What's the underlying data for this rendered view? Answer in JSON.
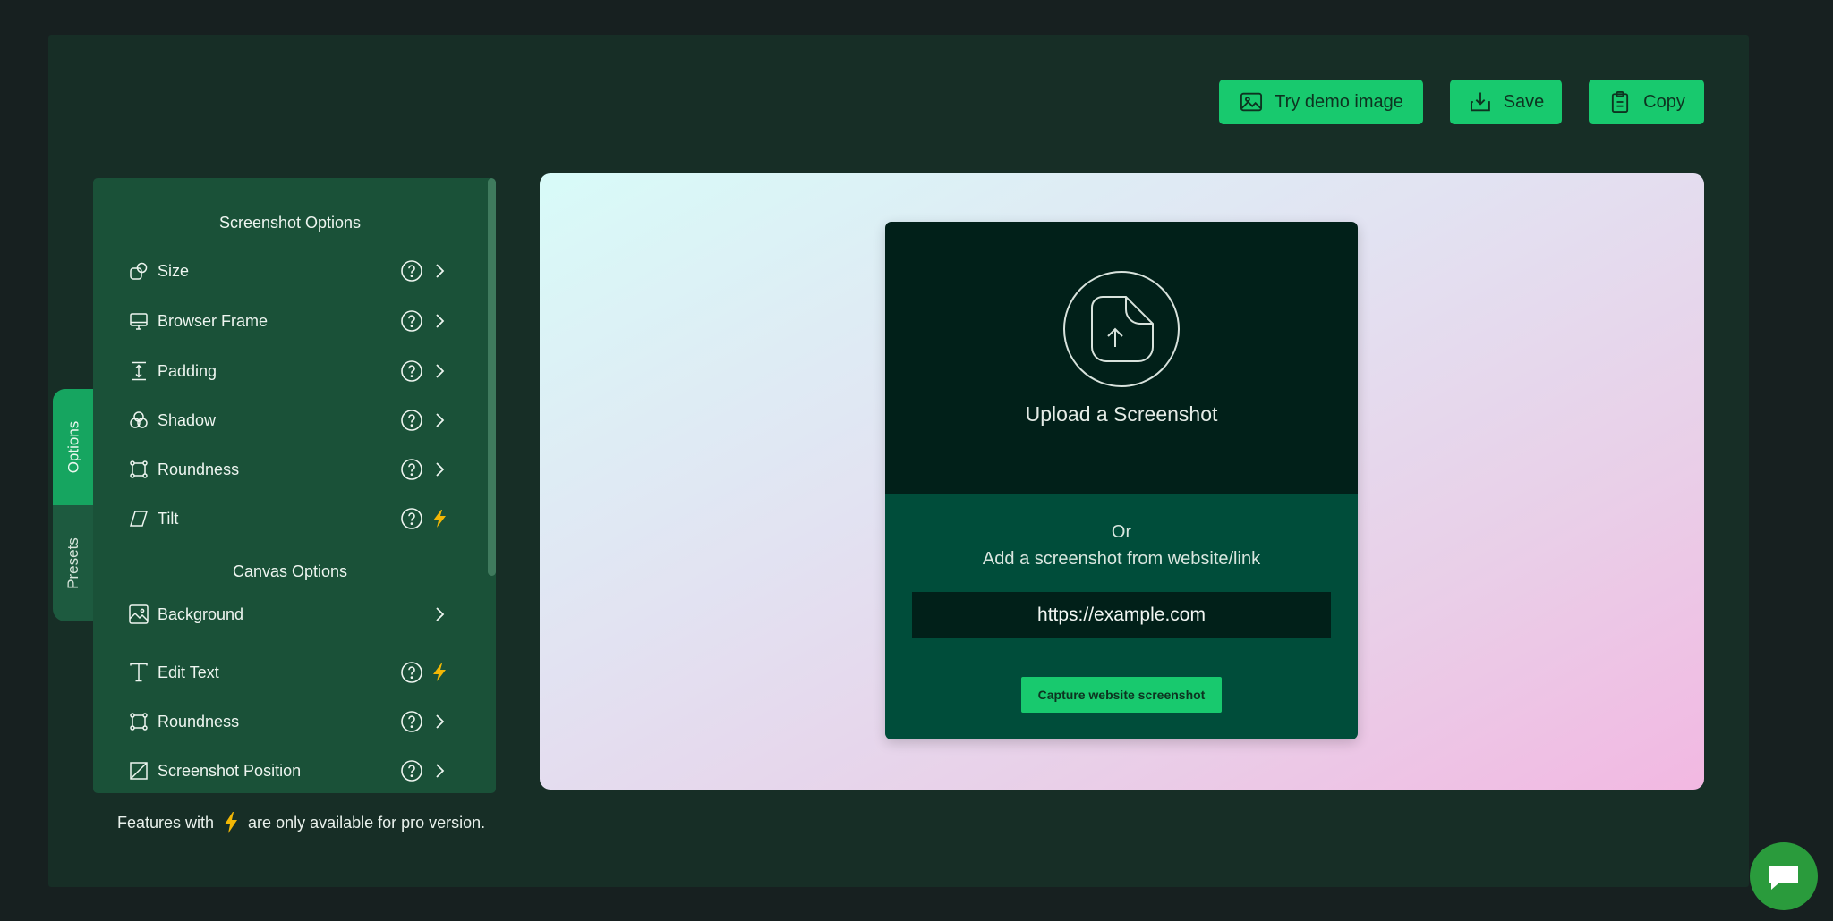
{
  "toolbar": {
    "demo_label": "Try demo image",
    "save_label": "Save",
    "copy_label": "Copy"
  },
  "side_tabs": {
    "options": "Options",
    "presets": "Presets",
    "active": "Options"
  },
  "panel": {
    "screenshot_title": "Screenshot Options",
    "canvas_title": "Canvas Options",
    "screenshot_items": [
      {
        "label": "Size",
        "icon": "shapes-icon",
        "help": true,
        "trailing": "chevron"
      },
      {
        "label": "Browser Frame",
        "icon": "monitor-icon",
        "help": true,
        "trailing": "chevron"
      },
      {
        "label": "Padding",
        "icon": "padding-icon",
        "help": true,
        "trailing": "chevron"
      },
      {
        "label": "Shadow",
        "icon": "shadow-icon",
        "help": true,
        "trailing": "chevron"
      },
      {
        "label": "Roundness",
        "icon": "roundness-icon",
        "help": true,
        "trailing": "chevron"
      },
      {
        "label": "Tilt",
        "icon": "tilt-icon",
        "help": true,
        "trailing": "pro-bolt"
      }
    ],
    "canvas_items": [
      {
        "label": "Background",
        "icon": "image-icon",
        "help": false,
        "trailing": "chevron"
      },
      {
        "label": "Edit Text",
        "icon": "text-icon",
        "help": true,
        "trailing": "pro-bolt"
      },
      {
        "label": "Roundness",
        "icon": "roundness-icon",
        "help": true,
        "trailing": "chevron"
      },
      {
        "label": "Screenshot Position",
        "icon": "position-icon",
        "help": true,
        "trailing": "chevron"
      }
    ]
  },
  "footnote": {
    "before": "Features with",
    "after": "are only available for pro version."
  },
  "uploader": {
    "title": "Upload a Screenshot",
    "or": "Or",
    "add_text": "Add a screenshot from website/link",
    "url_placeholder": "https://example.com",
    "capture_label": "Capture website screenshot"
  },
  "colors": {
    "accent": "#18c96e",
    "pro_bolt": "#f2b705",
    "panel": "#1a5138",
    "background": "#172e26"
  }
}
